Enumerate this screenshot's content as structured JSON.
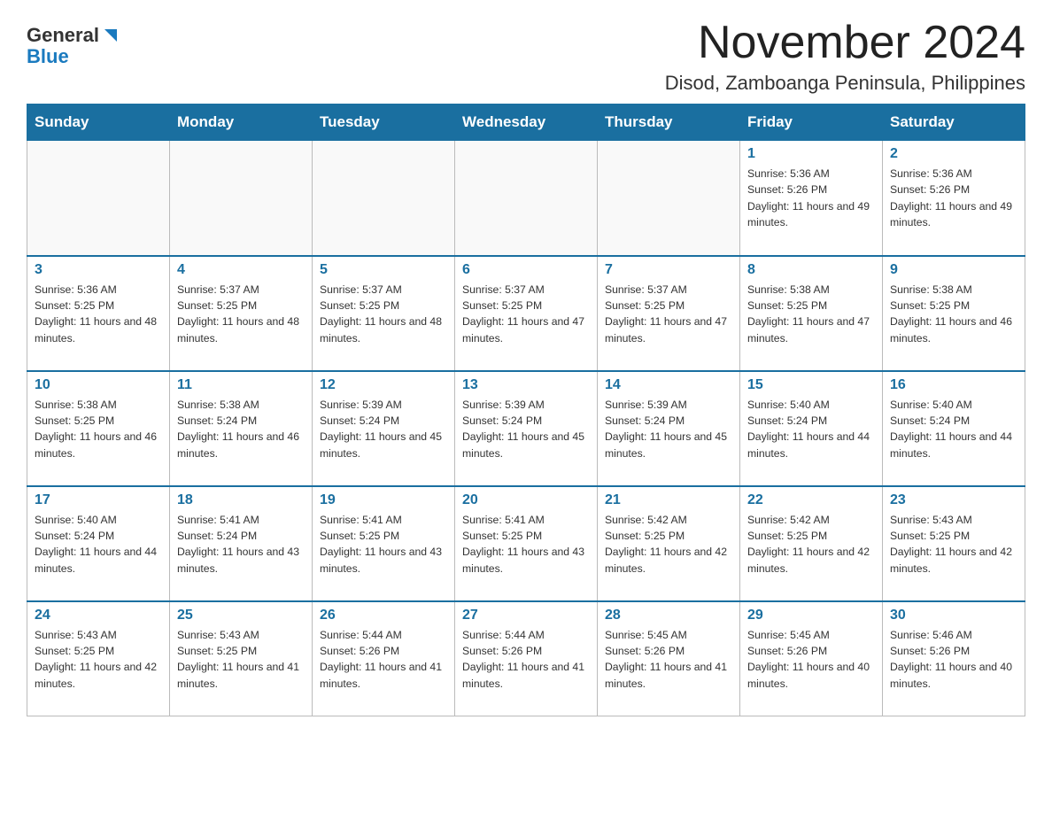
{
  "logo": {
    "general": "General",
    "blue": "Blue"
  },
  "title": "November 2024",
  "subtitle": "Disod, Zamboanga Peninsula, Philippines",
  "weekdays": [
    "Sunday",
    "Monday",
    "Tuesday",
    "Wednesday",
    "Thursday",
    "Friday",
    "Saturday"
  ],
  "weeks": [
    [
      {
        "day": "",
        "info": ""
      },
      {
        "day": "",
        "info": ""
      },
      {
        "day": "",
        "info": ""
      },
      {
        "day": "",
        "info": ""
      },
      {
        "day": "",
        "info": ""
      },
      {
        "day": "1",
        "info": "Sunrise: 5:36 AM\nSunset: 5:26 PM\nDaylight: 11 hours and 49 minutes."
      },
      {
        "day": "2",
        "info": "Sunrise: 5:36 AM\nSunset: 5:26 PM\nDaylight: 11 hours and 49 minutes."
      }
    ],
    [
      {
        "day": "3",
        "info": "Sunrise: 5:36 AM\nSunset: 5:25 PM\nDaylight: 11 hours and 48 minutes."
      },
      {
        "day": "4",
        "info": "Sunrise: 5:37 AM\nSunset: 5:25 PM\nDaylight: 11 hours and 48 minutes."
      },
      {
        "day": "5",
        "info": "Sunrise: 5:37 AM\nSunset: 5:25 PM\nDaylight: 11 hours and 48 minutes."
      },
      {
        "day": "6",
        "info": "Sunrise: 5:37 AM\nSunset: 5:25 PM\nDaylight: 11 hours and 47 minutes."
      },
      {
        "day": "7",
        "info": "Sunrise: 5:37 AM\nSunset: 5:25 PM\nDaylight: 11 hours and 47 minutes."
      },
      {
        "day": "8",
        "info": "Sunrise: 5:38 AM\nSunset: 5:25 PM\nDaylight: 11 hours and 47 minutes."
      },
      {
        "day": "9",
        "info": "Sunrise: 5:38 AM\nSunset: 5:25 PM\nDaylight: 11 hours and 46 minutes."
      }
    ],
    [
      {
        "day": "10",
        "info": "Sunrise: 5:38 AM\nSunset: 5:25 PM\nDaylight: 11 hours and 46 minutes."
      },
      {
        "day": "11",
        "info": "Sunrise: 5:38 AM\nSunset: 5:24 PM\nDaylight: 11 hours and 46 minutes."
      },
      {
        "day": "12",
        "info": "Sunrise: 5:39 AM\nSunset: 5:24 PM\nDaylight: 11 hours and 45 minutes."
      },
      {
        "day": "13",
        "info": "Sunrise: 5:39 AM\nSunset: 5:24 PM\nDaylight: 11 hours and 45 minutes."
      },
      {
        "day": "14",
        "info": "Sunrise: 5:39 AM\nSunset: 5:24 PM\nDaylight: 11 hours and 45 minutes."
      },
      {
        "day": "15",
        "info": "Sunrise: 5:40 AM\nSunset: 5:24 PM\nDaylight: 11 hours and 44 minutes."
      },
      {
        "day": "16",
        "info": "Sunrise: 5:40 AM\nSunset: 5:24 PM\nDaylight: 11 hours and 44 minutes."
      }
    ],
    [
      {
        "day": "17",
        "info": "Sunrise: 5:40 AM\nSunset: 5:24 PM\nDaylight: 11 hours and 44 minutes."
      },
      {
        "day": "18",
        "info": "Sunrise: 5:41 AM\nSunset: 5:24 PM\nDaylight: 11 hours and 43 minutes."
      },
      {
        "day": "19",
        "info": "Sunrise: 5:41 AM\nSunset: 5:25 PM\nDaylight: 11 hours and 43 minutes."
      },
      {
        "day": "20",
        "info": "Sunrise: 5:41 AM\nSunset: 5:25 PM\nDaylight: 11 hours and 43 minutes."
      },
      {
        "day": "21",
        "info": "Sunrise: 5:42 AM\nSunset: 5:25 PM\nDaylight: 11 hours and 42 minutes."
      },
      {
        "day": "22",
        "info": "Sunrise: 5:42 AM\nSunset: 5:25 PM\nDaylight: 11 hours and 42 minutes."
      },
      {
        "day": "23",
        "info": "Sunrise: 5:43 AM\nSunset: 5:25 PM\nDaylight: 11 hours and 42 minutes."
      }
    ],
    [
      {
        "day": "24",
        "info": "Sunrise: 5:43 AM\nSunset: 5:25 PM\nDaylight: 11 hours and 42 minutes."
      },
      {
        "day": "25",
        "info": "Sunrise: 5:43 AM\nSunset: 5:25 PM\nDaylight: 11 hours and 41 minutes."
      },
      {
        "day": "26",
        "info": "Sunrise: 5:44 AM\nSunset: 5:26 PM\nDaylight: 11 hours and 41 minutes."
      },
      {
        "day": "27",
        "info": "Sunrise: 5:44 AM\nSunset: 5:26 PM\nDaylight: 11 hours and 41 minutes."
      },
      {
        "day": "28",
        "info": "Sunrise: 5:45 AM\nSunset: 5:26 PM\nDaylight: 11 hours and 41 minutes."
      },
      {
        "day": "29",
        "info": "Sunrise: 5:45 AM\nSunset: 5:26 PM\nDaylight: 11 hours and 40 minutes."
      },
      {
        "day": "30",
        "info": "Sunrise: 5:46 AM\nSunset: 5:26 PM\nDaylight: 11 hours and 40 minutes."
      }
    ]
  ]
}
